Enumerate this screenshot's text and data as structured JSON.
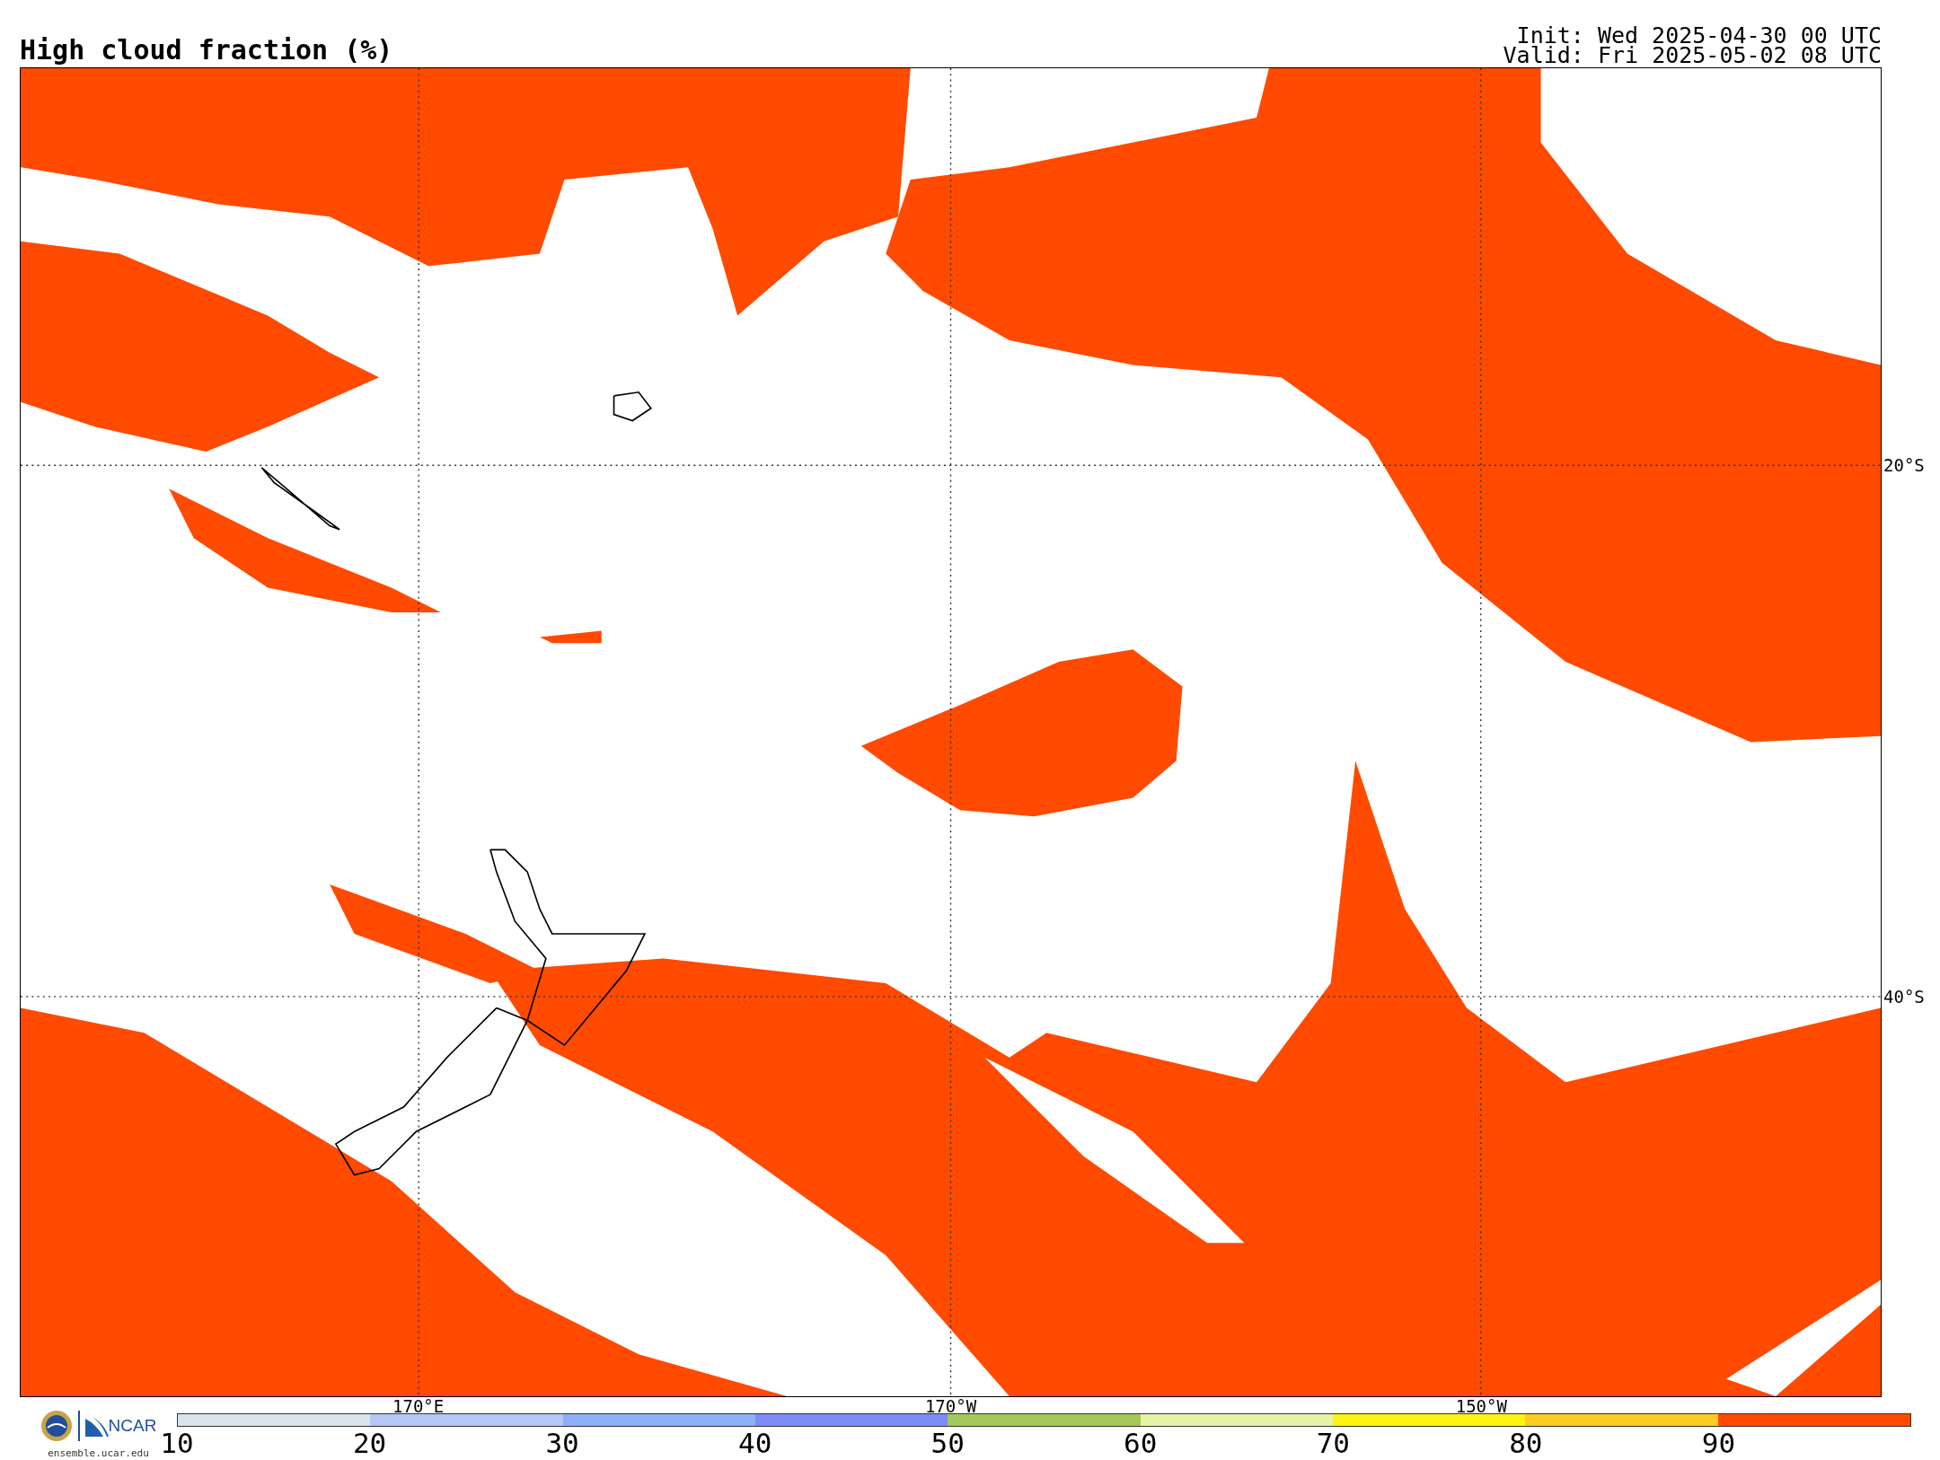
{
  "title": "High cloud fraction (%)",
  "init": "Init: Wed 2025-04-30 00 UTC",
  "valid": "Valid: Fri 2025-05-02 08 UTC",
  "map": {
    "latitude_labels": [
      "20°S",
      "40°S"
    ],
    "longitude_labels": [
      "170°E",
      "170°W",
      "150°W"
    ]
  },
  "colorbar": {
    "segments": [
      {
        "color": "#d9e3ec"
      },
      {
        "color": "#b4c8f8"
      },
      {
        "color": "#8cb0f8"
      },
      {
        "color": "#7d8cf7"
      },
      {
        "color": "#a3c95c"
      },
      {
        "color": "#e8f2a8"
      },
      {
        "color": "#fff314"
      },
      {
        "color": "#ffcc22"
      },
      {
        "color": "#ff4a00"
      }
    ],
    "tick_labels": [
      "10",
      "20",
      "30",
      "40",
      "50",
      "60",
      "70",
      "80",
      "90"
    ]
  },
  "footer": {
    "logo_text": "NCAR",
    "url": "ensemble.ucar.edu"
  }
}
